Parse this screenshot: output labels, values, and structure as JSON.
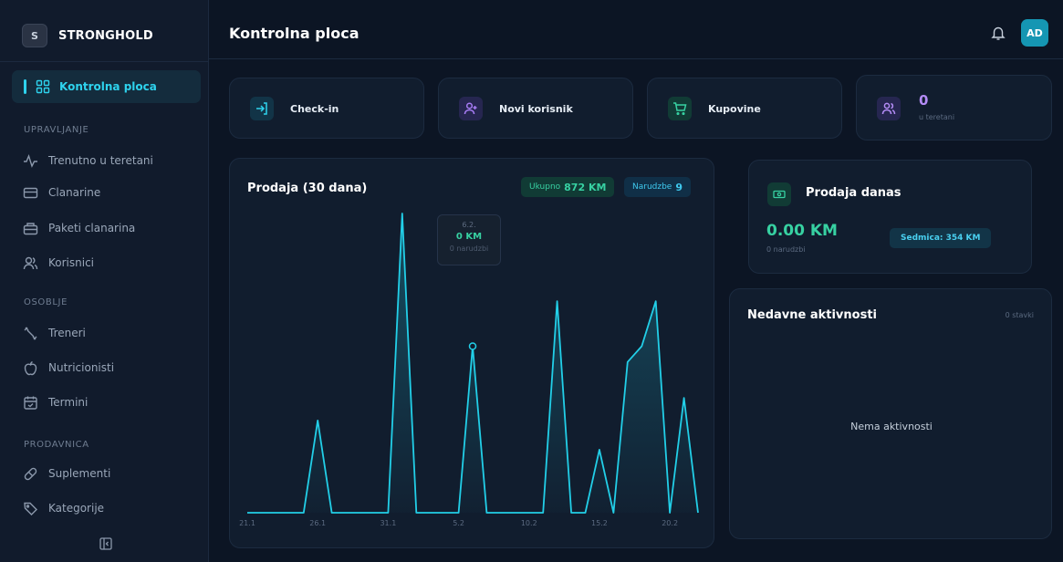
{
  "app": {
    "name": "STRONGHOLD",
    "logo_letter": "S"
  },
  "sidebar": {
    "active": {
      "label": "Kontrolna ploca",
      "icon": "dashboard-icon"
    },
    "sections": [
      {
        "title": "UPRAVLJANJE",
        "items": [
          {
            "label": "Trenutno u teretani",
            "icon": "activity-icon"
          },
          {
            "label": "Clanarine",
            "icon": "card-icon"
          },
          {
            "label": "Paketi clanarina",
            "icon": "package-icon"
          },
          {
            "label": "Korisnici",
            "icon": "users-icon"
          }
        ]
      },
      {
        "title": "OSOBLJE",
        "items": [
          {
            "label": "Treneri",
            "icon": "dumbbell-icon"
          },
          {
            "label": "Nutricionisti",
            "icon": "apple-icon"
          },
          {
            "label": "Termini",
            "icon": "calendar-icon"
          }
        ]
      },
      {
        "title": "PRODAVNICA",
        "items": [
          {
            "label": "Suplementi",
            "icon": "pill-icon"
          },
          {
            "label": "Kategorije",
            "icon": "tag-icon"
          }
        ]
      }
    ]
  },
  "header": {
    "title": "Kontrolna ploca",
    "avatar_initials": "AD"
  },
  "quick_actions": [
    {
      "label": "Check-in",
      "icon": "login-icon",
      "color": "#2ed3ee"
    },
    {
      "label": "Novi korisnik",
      "icon": "user-plus-icon",
      "color": "#a77cf4"
    },
    {
      "label": "Kupovine",
      "icon": "cart-icon",
      "color": "#37d1a2"
    }
  ],
  "gym_stat": {
    "value": "0",
    "label": "u teretani",
    "icon": "users-icon"
  },
  "sales_chart": {
    "title": "Prodaja (30 dana)",
    "total_label": "Ukupno",
    "total_value": "872 KM",
    "orders_label": "Narudzbe",
    "orders_value": "9",
    "tooltip": {
      "date": "6.2.",
      "value": "0 KM",
      "orders": "0 narudzbi"
    }
  },
  "chart_data": {
    "type": "area",
    "x": [
      "21.1",
      "22.1",
      "23.1",
      "24.1",
      "25.1",
      "26.1",
      "27.1",
      "28.1",
      "29.1",
      "30.1",
      "31.1",
      "1.2",
      "2.2",
      "3.2",
      "4.2",
      "5.2",
      "6.2",
      "7.2",
      "8.2",
      "9.2",
      "10.2",
      "11.2",
      "12.2",
      "13.2",
      "14.2",
      "15.2",
      "16.2",
      "17.2",
      "18.2",
      "19.2",
      "20.2"
    ],
    "x_tick_labels": [
      "21.1",
      "26.1",
      "31.1",
      "5.2",
      "10.2",
      "15.2",
      "20.2"
    ],
    "values": [
      0,
      0,
      0,
      0,
      0,
      82,
      0,
      0,
      0,
      0,
      0,
      266,
      0,
      0,
      0,
      0,
      148,
      0,
      0,
      0,
      0,
      0,
      188,
      0,
      0,
      56,
      0,
      134,
      148,
      188,
      0,
      102,
      0
    ],
    "relative_values_note_removed": "",
    "highlight_index": 16,
    "color": "#22cfe8"
  },
  "today": {
    "title": "Prodaja danas",
    "amount": "0.00 KM",
    "orders": "0 narudzbi",
    "week_label": "Sedmica: 354 KM"
  },
  "activity": {
    "title": "Nedavne aktivnosti",
    "count": "0 stavki",
    "empty": "Nema aktivnosti"
  }
}
